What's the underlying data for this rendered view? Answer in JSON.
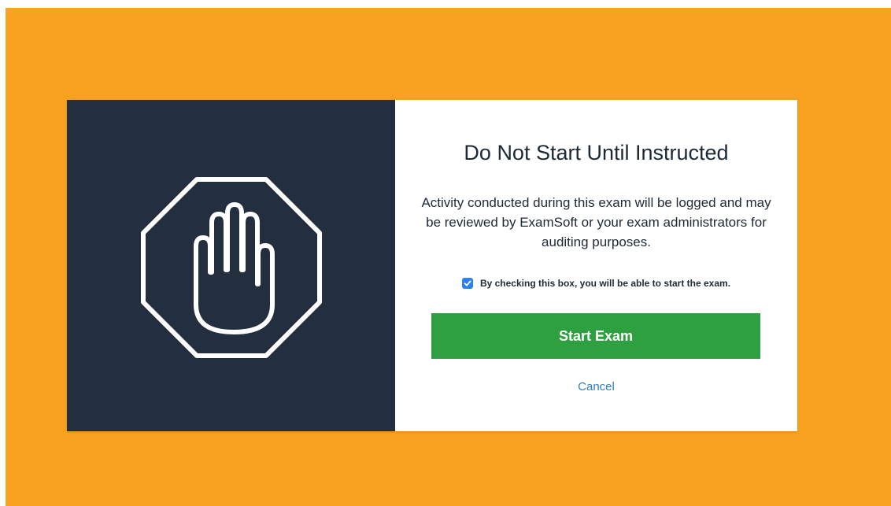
{
  "dialog": {
    "title": "Do Not Start Until Instructed",
    "description": "Activity conducted during this exam will be logged and may be reviewed by ExamSoft or your exam administrators for auditing purposes.",
    "consent_label": "By checking this box, you will be able to start the exam.",
    "consent_checked": true,
    "start_label": "Start Exam",
    "cancel_label": "Cancel"
  },
  "icons": {
    "left_panel": "stop-hand-icon",
    "checkbox_mark": "checkmark-icon"
  },
  "colors": {
    "backdrop": "#f8a21f",
    "left_panel": "#232f3e",
    "primary_button": "#2fa03f",
    "link": "#2e7cc7",
    "checkbox": "#2d7ff5",
    "text": "#1e2935"
  }
}
